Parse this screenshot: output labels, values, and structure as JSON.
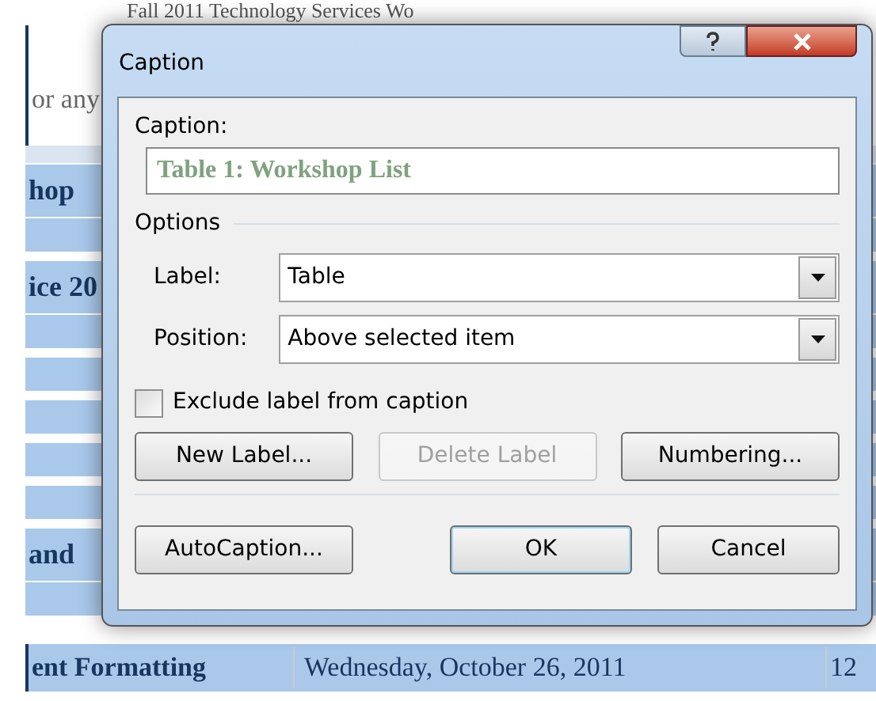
{
  "document": {
    "heading": "Fall 2011 Technology Services Wo",
    "intro": "or any",
    "rows": [
      {
        "kind": "gap"
      },
      {
        "kind": "band",
        "text": "hop"
      },
      {
        "kind": "stripe"
      },
      {
        "kind": "band",
        "text": "ice 20"
      },
      {
        "kind": "stripe"
      },
      {
        "kind": "stripe"
      },
      {
        "kind": "stripe"
      },
      {
        "kind": "stripe"
      },
      {
        "kind": "stripe"
      },
      {
        "kind": "band",
        "text": "and"
      },
      {
        "kind": "stripe"
      },
      {
        "kind": "row",
        "cells": [
          "ent Formatting",
          "Wednesday, October 26, 2011",
          "12"
        ]
      }
    ]
  },
  "dialog": {
    "title": "Caption",
    "caption": {
      "label": "Caption:",
      "value": "Table 1: Workshop List"
    },
    "options_heading": "Options",
    "fields": [
      {
        "label": "Label:",
        "value": "Table"
      },
      {
        "label": "Position:",
        "value": "Above selected item"
      }
    ],
    "checkbox": {
      "label": "Exclude label from caption",
      "checked": false
    },
    "buttons": [
      {
        "label": "New Label...",
        "disabled": false
      },
      {
        "label": "Delete Label",
        "disabled": true
      },
      {
        "label": "Numbering...",
        "disabled": false
      }
    ],
    "footer_buttons": [
      {
        "label": "AutoCaption...",
        "default": false,
        "kind": "left"
      },
      {
        "label": "OK",
        "default": true,
        "kind": "right"
      },
      {
        "label": "Cancel",
        "default": false,
        "kind": "right"
      }
    ]
  }
}
